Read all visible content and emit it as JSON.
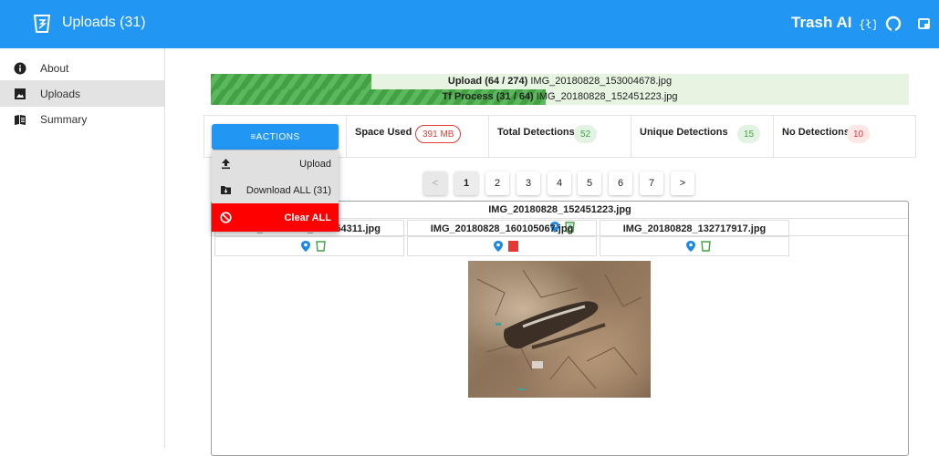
{
  "appbar": {
    "title": "Uploads (31)",
    "brand": "Trash AI",
    "icons": [
      "trash-logo-icon",
      "code-braces-icon",
      "github-icon",
      "window-icon"
    ],
    "color": "#2196f3"
  },
  "sidebar": {
    "items": [
      {
        "label": "About",
        "icon": "info-icon"
      },
      {
        "label": "Uploads",
        "icon": "image-icon",
        "active": true
      },
      {
        "label": "Summary",
        "icon": "book-icon"
      }
    ]
  },
  "progress": {
    "upload_label": "Upload (64 / 274)",
    "upload_file": " IMG_20180828_153004678.jpg",
    "upload_fraction": 0.23,
    "tf_label": "Tf Process (31 / 64)",
    "tf_file": " IMG_20180828_152451223.jpg",
    "tf_fraction": 0.48
  },
  "stats": {
    "space_used_label": "Space Used",
    "space_used_value": "391 MB",
    "total_detections_label": "Total Detections",
    "total_detections_value": "52",
    "unique_detections_label": "Unique Detections",
    "unique_detections_value": "15",
    "no_detections_label": "No Detections",
    "no_detections_value": "10"
  },
  "actions": {
    "button_label": "≡ACTIONS",
    "menu": [
      {
        "label": "Upload",
        "icon": "upload-icon"
      },
      {
        "label": "Download ALL (31)",
        "icon": "folder-download-icon"
      },
      {
        "label": "Clear ALL",
        "icon": "cancel-icon"
      }
    ]
  },
  "pagination": {
    "prev": "<",
    "pages": [
      "1",
      "2",
      "3",
      "4",
      "5",
      "6",
      "7"
    ],
    "current": "1",
    "next": ">"
  },
  "main_image": {
    "filename": "IMG_20180828_152451223.jpg"
  },
  "thumbnails": [
    {
      "filename": "IMG_20180828_160054311.jpg",
      "status": "green"
    },
    {
      "filename": "IMG_20180828_160105067.jpg",
      "status": "red"
    },
    {
      "filename": "IMG_20180828_132717917.jpg",
      "status": "green"
    }
  ],
  "colors": {
    "pin": "#1e88e5",
    "bin_ok": "#43a047",
    "bin_bad": "#e53935",
    "clear": "#ff0000"
  }
}
